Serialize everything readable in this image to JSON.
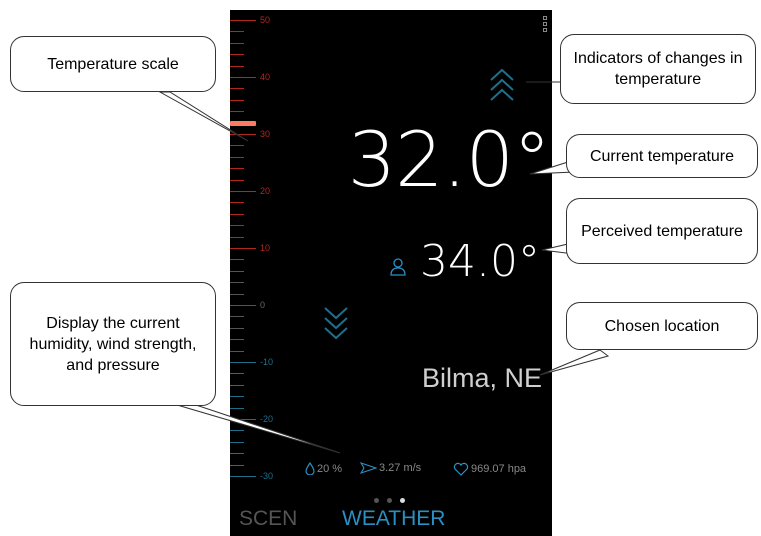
{
  "scale": {
    "labels": [
      "50",
      "40",
      "30",
      "20",
      "10",
      "0",
      "-10",
      "-20",
      "-30"
    ],
    "current_value": 32.0
  },
  "current_temp": "32.0°",
  "perceived_temp": "34.0°",
  "location": "Bilma, NE",
  "stats": {
    "humidity": "20 %",
    "wind": "3.27 m/s",
    "pressure": "969.07 hpa"
  },
  "tabs": [
    "SCEN",
    "WEATHER"
  ],
  "callouts": {
    "temperature_scale": "Temperature scale",
    "indicators": "Indicators of changes in temperature",
    "current_temperature": "Current temperature",
    "perceived_temperature": "Perceived temperature",
    "chosen_location": "Chosen location",
    "display_stats": "Display the current humidity, wind strength, and pressure"
  },
  "colors": {
    "scale_warm": "#b3261e",
    "scale_cold": "#1f6f8b",
    "marker": "#ff7a63",
    "accent": "#2b8fc4"
  },
  "icons": [
    "menu-icon",
    "chevron-up-icon",
    "chevron-down-icon",
    "person-icon",
    "droplet-icon",
    "wind-icon",
    "heart-icon"
  ]
}
